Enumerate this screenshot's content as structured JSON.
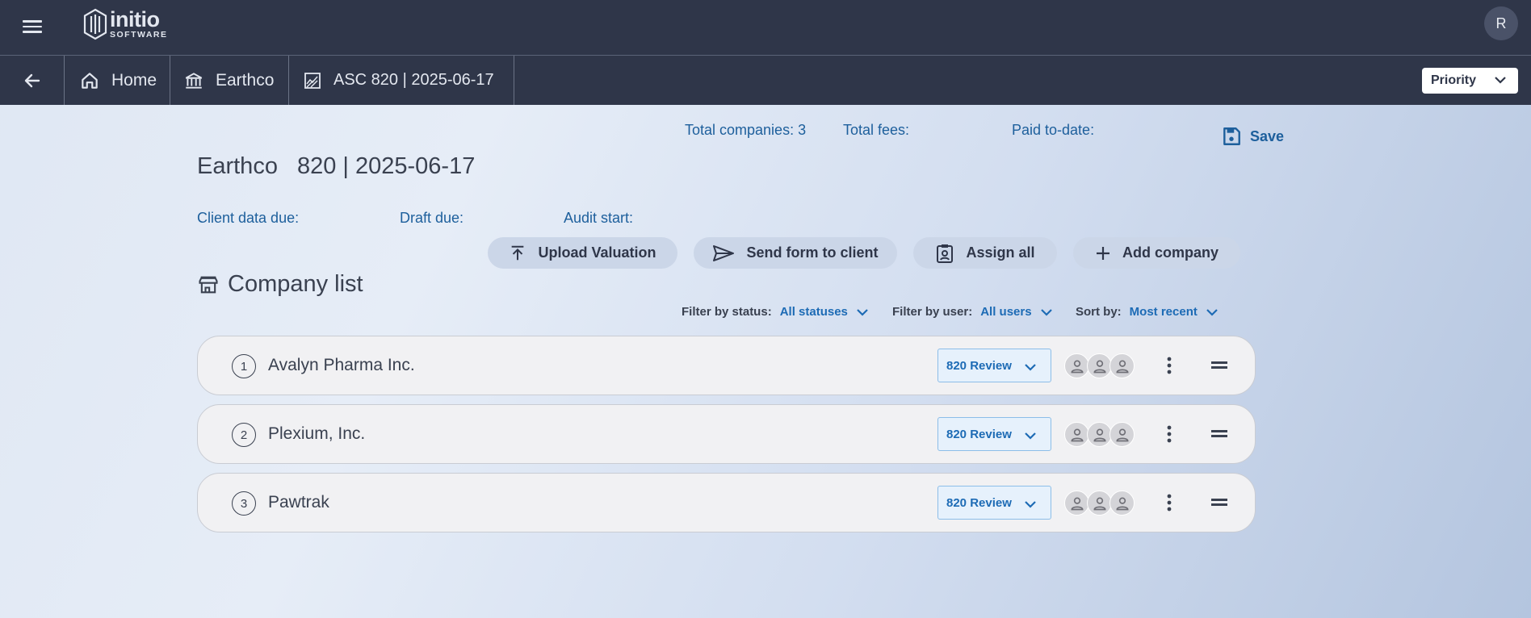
{
  "app": {
    "logo_main": "initio",
    "logo_sub": "SOFTWARE",
    "user_initial": "R"
  },
  "nav": {
    "breadcrumbs": [
      "Home",
      "Earthco",
      "ASC 820 | 2025-06-17"
    ],
    "priority_label": "Priority"
  },
  "summary": {
    "total_companies": "Total companies: 3",
    "total_fees": "Total fees:",
    "paid_to_date": "Paid to-date:",
    "save_label": "Save"
  },
  "project": {
    "client": "Earthco",
    "engagement": "820 | 2025-06-17",
    "client_data_due": "Client data due:",
    "draft_due": "Draft due:",
    "audit_start": "Audit start:"
  },
  "actions": {
    "upload": "Upload Valuation",
    "send_form": "Send form to client",
    "assign_all": "Assign all",
    "add_company": "Add company"
  },
  "company_list": {
    "title": "Company list",
    "filter_status_label": "Filter by status:",
    "filter_status_value": "All statuses",
    "filter_user_label": "Filter by user:",
    "filter_user_value": "All users",
    "sort_label": "Sort by:",
    "sort_value": "Most recent",
    "rows": [
      {
        "num": "1",
        "name": "Avalyn Pharma Inc.",
        "status": "820 Review"
      },
      {
        "num": "2",
        "name": "Plexium, Inc.",
        "status": "820 Review"
      },
      {
        "num": "3",
        "name": "Pawtrak",
        "status": "820 Review"
      }
    ]
  },
  "colors": {
    "topbar": "#2f3649",
    "accent": "#1d5f9c",
    "link": "#1d6bb5",
    "button_bg": "#cbd6e8"
  },
  "icons": [
    "menu-icon",
    "initio-logo-icon",
    "arrow-left-icon",
    "home-icon",
    "bank-icon",
    "chart-icon",
    "chevron-down-icon",
    "save-icon",
    "upload-icon",
    "send-icon",
    "clipboard-user-icon",
    "plus-icon",
    "store-icon",
    "user-icon",
    "more-vertical-icon",
    "drag-handle-icon"
  ]
}
